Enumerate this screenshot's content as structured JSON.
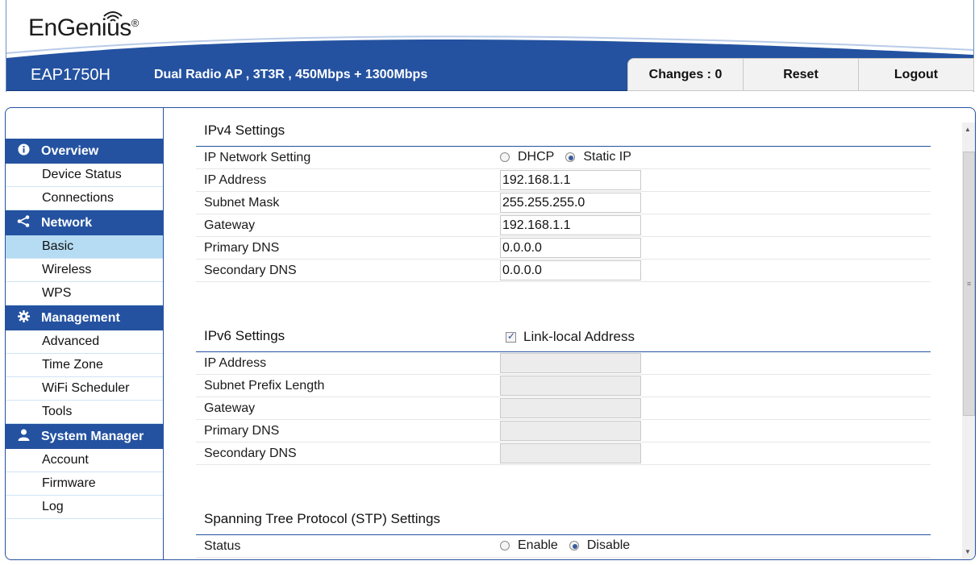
{
  "header": {
    "logo_text": "EnGenius",
    "logo_mark": "®",
    "model": "EAP1750H",
    "description": "Dual Radio AP , 3T3R , 450Mbps + 1300Mbps",
    "buttons": {
      "changes": "Changes : 0",
      "reset": "Reset",
      "logout": "Logout"
    }
  },
  "sidebar": {
    "sections": [
      {
        "title": "Overview",
        "icon": "info-icon",
        "items": [
          "Device Status",
          "Connections"
        ]
      },
      {
        "title": "Network",
        "icon": "share-icon",
        "items": [
          "Basic",
          "Wireless",
          "WPS"
        ]
      },
      {
        "title": "Management",
        "icon": "gear-icon",
        "items": [
          "Advanced",
          "Time Zone",
          "WiFi Scheduler",
          "Tools"
        ]
      },
      {
        "title": "System Manager",
        "icon": "user-icon",
        "items": [
          "Account",
          "Firmware",
          "Log"
        ]
      }
    ],
    "active_item": "Basic"
  },
  "ipv4": {
    "title": "IPv4 Settings",
    "network_setting_label": "IP Network Setting",
    "dhcp_label": "DHCP",
    "static_label": "Static IP",
    "selected": "Static IP",
    "fields": [
      {
        "label": "IP Address",
        "value": "192.168.1.1"
      },
      {
        "label": "Subnet Mask",
        "value": "255.255.255.0"
      },
      {
        "label": "Gateway",
        "value": "192.168.1.1"
      },
      {
        "label": "Primary DNS",
        "value": "0.0.0.0"
      },
      {
        "label": "Secondary DNS",
        "value": "0.0.0.0"
      }
    ]
  },
  "ipv6": {
    "title": "IPv6 Settings",
    "link_local_label": "Link-local Address",
    "link_local_checked": true,
    "fields": [
      {
        "label": "IP Address",
        "value": ""
      },
      {
        "label": "Subnet Prefix Length",
        "value": ""
      },
      {
        "label": "Gateway",
        "value": ""
      },
      {
        "label": "Primary DNS",
        "value": ""
      },
      {
        "label": "Secondary DNS",
        "value": ""
      }
    ]
  },
  "stp": {
    "title": "Spanning Tree Protocol (STP) Settings",
    "status_label": "Status",
    "enable_label": "Enable",
    "disable_label": "Disable",
    "selected": "Disable"
  },
  "colors": {
    "brand_blue": "#2452a0",
    "active_nav": "#b5dcf3"
  }
}
